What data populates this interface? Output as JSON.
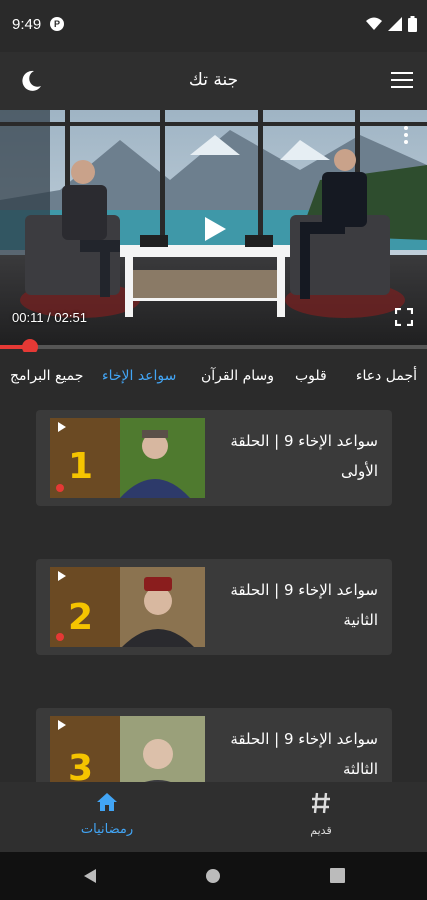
{
  "status": {
    "time": "9:49",
    "dnd_badge": "P",
    "icons": [
      "wifi-icon",
      "signal-icon",
      "battery-icon"
    ]
  },
  "app_bar": {
    "title": "جنة تك",
    "left_icon": "moon-icon",
    "right_icon": "menu-icon"
  },
  "player": {
    "time": "00:11 / 02:51",
    "progress": 0.07,
    "colors": {
      "accent": "#e53935"
    }
  },
  "tabs": [
    {
      "label": "أجمل دعاء",
      "active": false
    },
    {
      "label": "قلوب",
      "active": false
    },
    {
      "label": "وسام القرآن",
      "active": false
    },
    {
      "label": "سواعد الإخاء",
      "active": true
    },
    {
      "label": "جميع البرامج",
      "active": false
    }
  ],
  "episodes": [
    {
      "title": "سواعد الإخاء 9 | الحلقة الأولى",
      "number": "1"
    },
    {
      "title": "سواعد الإخاء 9 | الحلقة الثانية",
      "number": "2"
    },
    {
      "title": "سواعد الإخاء 9 | الحلقة الثالثة",
      "number": "3"
    }
  ],
  "bottom_nav": [
    {
      "label": "رمضانيات",
      "icon": "home-icon",
      "active": true
    },
    {
      "label": "قديم",
      "icon": "hash-icon",
      "active": false
    }
  ],
  "colors": {
    "active_blue": "#42a5f5",
    "background": "#2b2b2b",
    "card": "#3a3a3a"
  }
}
